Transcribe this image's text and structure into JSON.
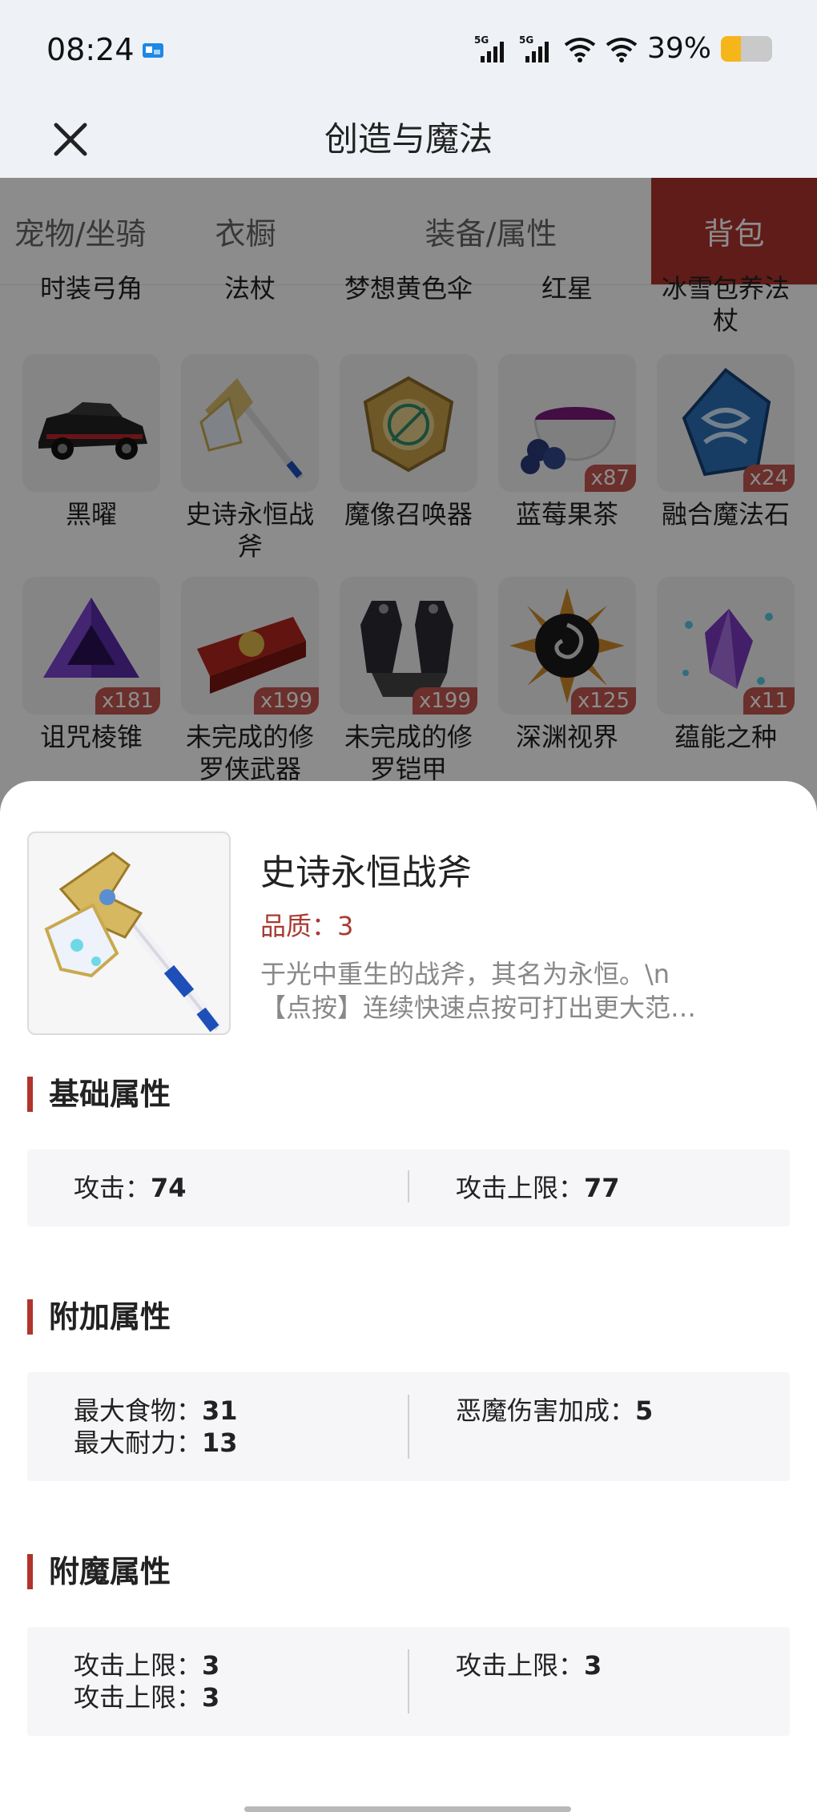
{
  "status_bar": {
    "time": "08:24",
    "signal1": "5G",
    "signal2": "5G",
    "battery_text": "39%",
    "battery_level": 0.39,
    "battery_color": "#f6b619"
  },
  "header": {
    "title": "创造与魔法",
    "close_icon": "close-icon"
  },
  "tabs": [
    {
      "label": "宠物/坐骑",
      "active": false
    },
    {
      "label": "衣橱",
      "active": false
    },
    {
      "label": "装备/属性",
      "active": false
    },
    {
      "label": "背包",
      "active": true
    }
  ],
  "partial_labels": [
    "时装弓角",
    "法杖",
    "梦想黄色伞",
    "红星",
    "冰雪包养法\n杖"
  ],
  "inventory_rows": [
    [
      {
        "name": "黑曜",
        "count": ""
      },
      {
        "name": "史诗永恒战斧",
        "count": ""
      },
      {
        "name": "魔像召唤器",
        "count": ""
      },
      {
        "name": "蓝莓果茶",
        "count": "x87"
      },
      {
        "name": "融合魔法石",
        "count": "x24"
      }
    ],
    [
      {
        "name": "诅咒棱锥",
        "count": "x181"
      },
      {
        "name": "未完成的修罗侠武器",
        "count": "x199"
      },
      {
        "name": "未完成的修罗铠甲",
        "count": "x199"
      },
      {
        "name": "深渊视界",
        "count": "x125"
      },
      {
        "name": "蕴能之种",
        "count": "x11"
      }
    ]
  ],
  "detail": {
    "name": "史诗永恒战斧",
    "quality": "品质：3",
    "desc_line1": "于光中重生的战斧，其名为永恒。\\n",
    "desc_line2": "【点按】连续快速点按可打出更大范…",
    "sections": {
      "basic": {
        "title": "基础属性",
        "left": [
          {
            "k": "攻击：",
            "v": "74"
          }
        ],
        "right": [
          {
            "k": "攻击上限：",
            "v": "77"
          }
        ]
      },
      "extra": {
        "title": "附加属性",
        "left": [
          {
            "k": "最大食物：",
            "v": "31"
          },
          {
            "k": "最大耐力：",
            "v": "13"
          }
        ],
        "right": [
          {
            "k": "恶魔伤害加成：",
            "v": "5"
          }
        ]
      },
      "enchant": {
        "title": "附魔属性",
        "left": [
          {
            "k": "攻击上限：",
            "v": "3"
          },
          {
            "k": "攻击上限：",
            "v": "3"
          }
        ],
        "right": [
          {
            "k": "攻击上限：",
            "v": "3"
          }
        ]
      }
    }
  },
  "colors": {
    "accent": "#b0342c",
    "quality": "#a83a33",
    "count_badge": "#c45650"
  }
}
